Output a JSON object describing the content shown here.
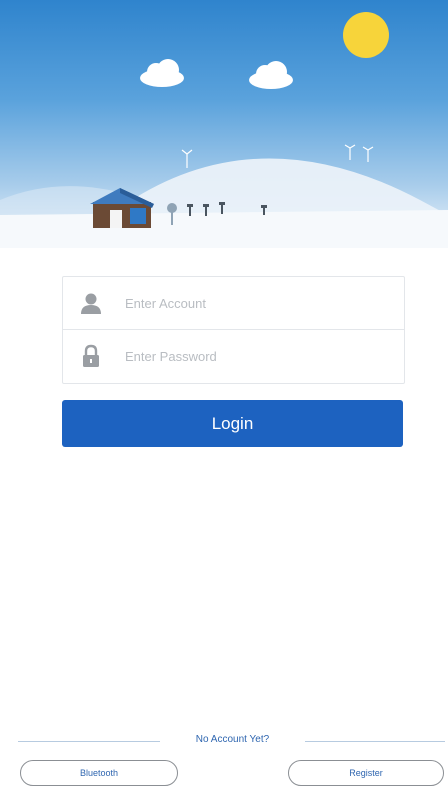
{
  "login": {
    "account_placeholder": "Enter Account",
    "password_placeholder": "Enter Password",
    "login_label": "Login"
  },
  "footer": {
    "no_account_text": "No Account Yet?",
    "bluetooth_label": "Bluetooth",
    "register_label": "Register"
  },
  "icons": {
    "account": "user-icon",
    "password": "lock-icon"
  },
  "colors": {
    "primary": "#1d62c0",
    "sky_top": "#2f84cd",
    "sun": "#f7d43a",
    "link_text": "#2f66b0"
  }
}
